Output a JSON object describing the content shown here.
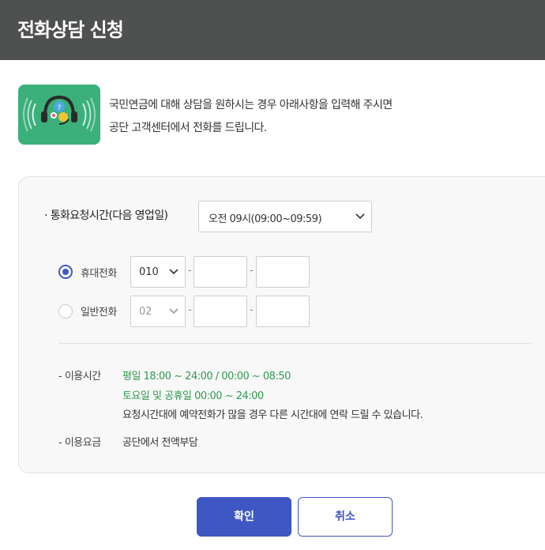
{
  "header": {
    "title": "전화상담 신청"
  },
  "intro": {
    "icon": "headset-chat-icon",
    "line1": "국민연금에 대해 상담을 원하시는 경우 아래사항을 입력해 주시면",
    "line2": "공단 고객센터에서 전화를 드립니다."
  },
  "form": {
    "time_label": "· 통화요청시간(다음 영업일)",
    "time_selected": "오전 09시(09:00~09:59)",
    "mobile": {
      "label": "휴대전화",
      "checked": true,
      "prefix": "010",
      "part2": "",
      "part3": ""
    },
    "landline": {
      "label": "일반전화",
      "checked": false,
      "prefix": "02",
      "part2": "",
      "part3": ""
    },
    "separator": "-"
  },
  "info": {
    "hours_label": "- 이용시간",
    "hours_weekday": "평일 18:00 ~ 24:00 / 00:00 ~ 08:50",
    "hours_weekend": "토요일 및 공휴일 00:00 ~ 24:00",
    "hours_note": "요청시간대에 예약전화가 많을 경우 다른 시간대에 연락 드릴 수 있습니다.",
    "fee_label": "- 이용요금",
    "fee_value": "공단에서 전액부담"
  },
  "buttons": {
    "confirm": "확인",
    "cancel": "취소"
  },
  "colors": {
    "header_bg": "#4f5050",
    "accent": "#3f57c2",
    "icon_bg": "#3bb07a",
    "hours_green": "#2f9a4b"
  }
}
